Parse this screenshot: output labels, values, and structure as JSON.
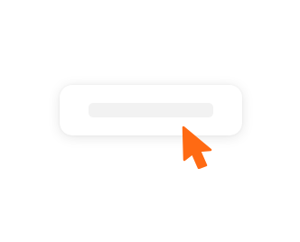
{
  "card": {
    "placeholder_bar": ""
  },
  "cursor": {
    "icon": "pointer-cursor-icon",
    "color": "#ff6a13"
  },
  "colors": {
    "background": "#ffffff",
    "card": "#ffffff",
    "bar": "#f2f2f2"
  }
}
